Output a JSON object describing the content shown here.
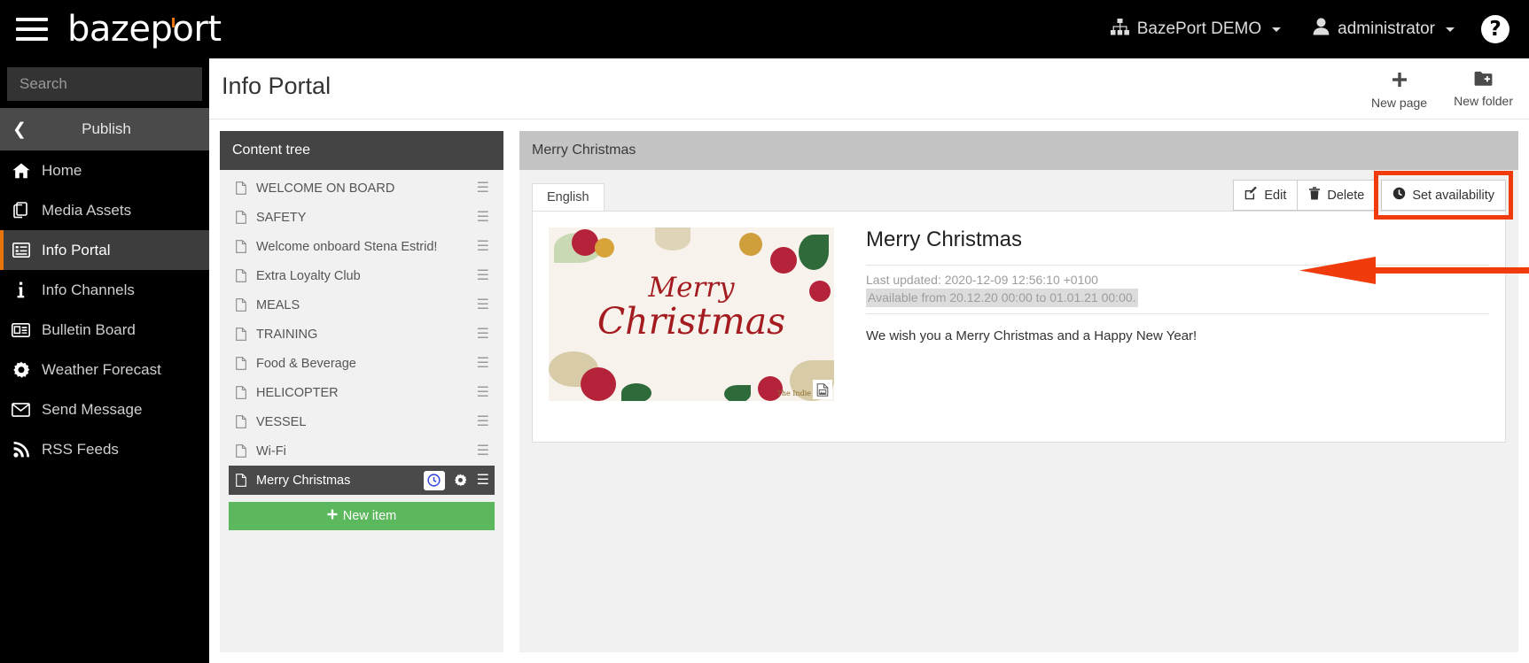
{
  "topbar": {
    "menu_icon": "hamburger-icon",
    "logo_text": "bazeport",
    "tenant": {
      "icon": "sitemap-icon",
      "label": "BazePort DEMO"
    },
    "user": {
      "icon": "user-icon",
      "label": "administrator"
    },
    "help": {
      "icon": "help-circle-icon",
      "label": "?"
    }
  },
  "sidebar": {
    "search": {
      "placeholder": "Search",
      "value": ""
    },
    "section": {
      "label": "Publish",
      "back_icon": "chevron-left-icon"
    },
    "items": [
      {
        "label": "Home",
        "icon": "home-icon",
        "active": false
      },
      {
        "label": "Media Assets",
        "icon": "copy-icon",
        "active": false
      },
      {
        "label": "Info Portal",
        "icon": "list-alt-icon",
        "active": true
      },
      {
        "label": "Info Channels",
        "icon": "info-icon",
        "active": false
      },
      {
        "label": "Bulletin Board",
        "icon": "id-card-icon",
        "active": false
      },
      {
        "label": "Weather Forecast",
        "icon": "gear-icon",
        "active": false
      },
      {
        "label": "Send Message",
        "icon": "envelope-icon",
        "active": false
      },
      {
        "label": "RSS Feeds",
        "icon": "rss-icon",
        "active": false
      }
    ]
  },
  "page": {
    "title": "Info Portal",
    "actions": [
      {
        "label": "New page",
        "icon": "plus-icon"
      },
      {
        "label": "New folder",
        "icon": "folder-plus-icon"
      }
    ]
  },
  "tree": {
    "header": "Content tree",
    "items": [
      {
        "label": "WELCOME ON BOARD",
        "selected": false
      },
      {
        "label": "SAFETY",
        "selected": false
      },
      {
        "label": "Welcome onboard Stena Estrid!",
        "selected": false
      },
      {
        "label": "Extra Loyalty Club",
        "selected": false
      },
      {
        "label": "MEALS",
        "selected": false
      },
      {
        "label": "TRAINING",
        "selected": false
      },
      {
        "label": "Food & Beverage",
        "selected": false
      },
      {
        "label": "HELICOPTER",
        "selected": false
      },
      {
        "label": "VESSEL",
        "selected": false
      },
      {
        "label": "Wi-Fi",
        "selected": false
      },
      {
        "label": "Merry Christmas",
        "selected": true
      }
    ],
    "new_item_label": "New item",
    "new_item_icon": "plus-icon",
    "row_icons": {
      "doc": "document-icon",
      "grip": "drag-handle-icon",
      "clock": "clock-icon",
      "gear": "gear-icon"
    }
  },
  "detail": {
    "header": "Merry Christmas",
    "tabs": [
      {
        "label": "English",
        "active": true
      }
    ],
    "actions": [
      {
        "label": "Edit",
        "icon": "edit-icon",
        "highlighted": false
      },
      {
        "label": "Delete",
        "icon": "trash-icon",
        "highlighted": false
      },
      {
        "label": "Set availability",
        "icon": "clock-icon",
        "highlighted": true
      }
    ],
    "article": {
      "title": "Merry Christmas",
      "last_updated": "Last updated: 2020-12-09 12:56:10 +0100",
      "availability": "Available from 20.12.20 00:00 to 01.01.21 00:00.",
      "body": "We wish you a Merry Christmas and a Happy New Year!",
      "thumbnail": {
        "line1": "Merry",
        "line2": "Christmas",
        "credit": "The Indie",
        "badge_icon": "image-file-icon"
      }
    }
  },
  "annotations": {
    "highlight_color": "#f03c0c",
    "arrow_target": "availability-line",
    "box_target": "set-availability-button"
  }
}
